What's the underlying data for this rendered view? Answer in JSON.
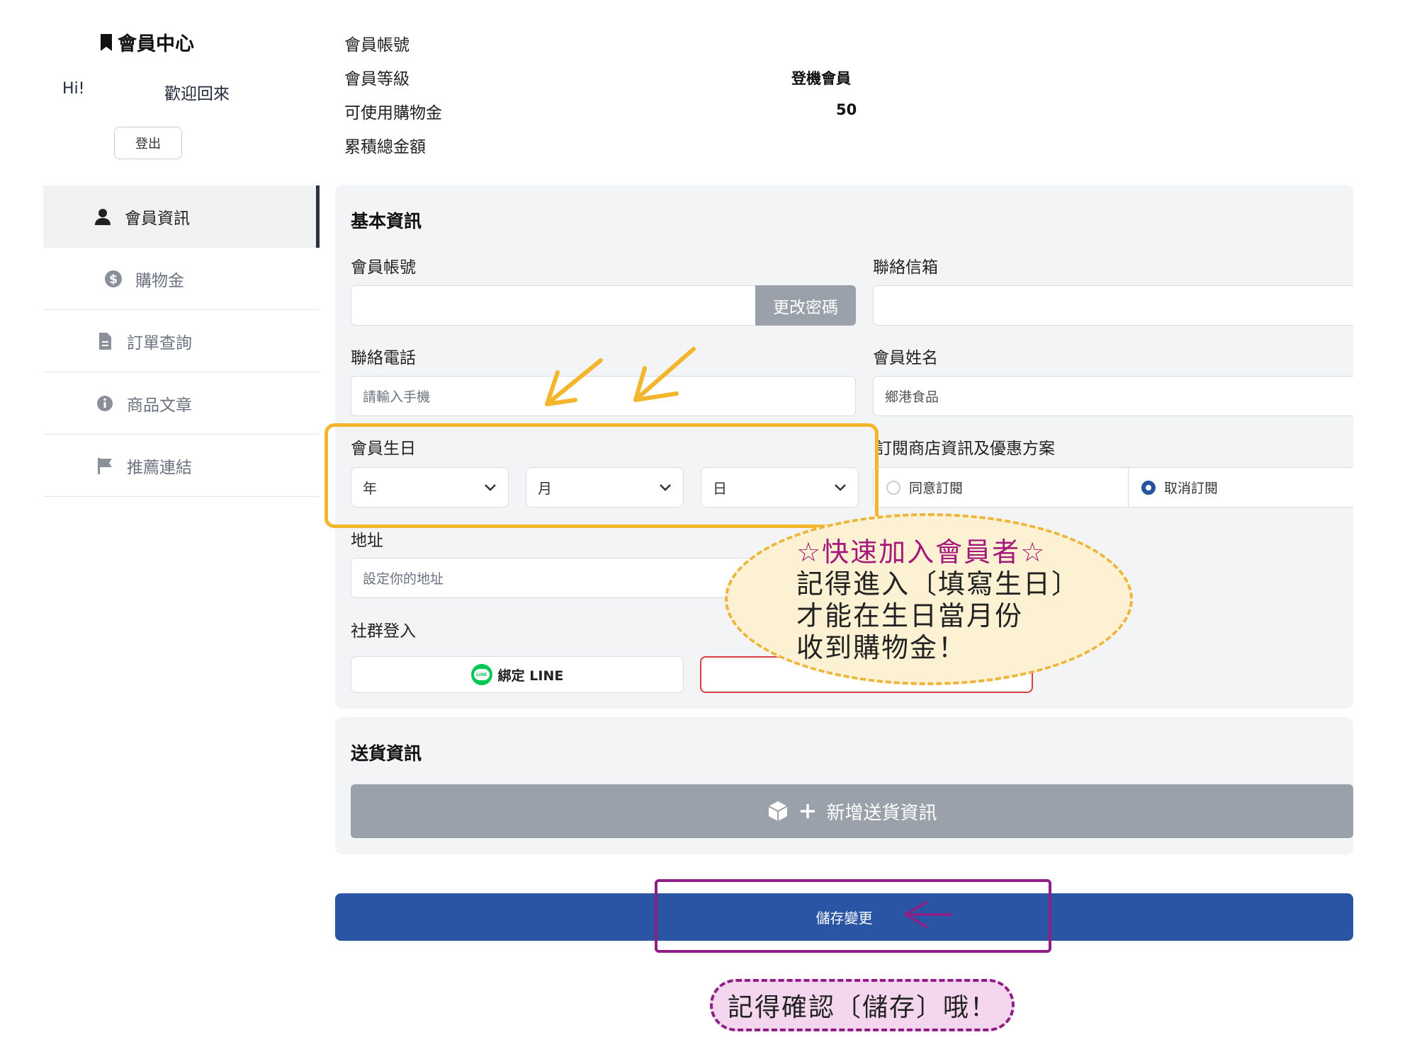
{
  "sidebar": {
    "brand": "會員中心",
    "greeting": "Hi!",
    "welcome": "歡迎回來",
    "logout_label": "登出",
    "items": [
      {
        "label": "會員資訊",
        "icon": "user-icon",
        "active": true
      },
      {
        "label": "購物金",
        "icon": "dollar-icon",
        "active": false
      },
      {
        "label": "訂單查詢",
        "icon": "document-icon",
        "active": false
      },
      {
        "label": "商品文章",
        "icon": "info-icon",
        "active": false
      },
      {
        "label": "推薦連結",
        "icon": "flag-icon",
        "active": false
      }
    ]
  },
  "summary": {
    "account_label": "會員帳號",
    "level_label": "會員等級",
    "level_value": "登機會員",
    "credit_label": "可使用購物金",
    "credit_value": "50",
    "total_label": "累積總金額"
  },
  "basic": {
    "title": "基本資訊",
    "account_label": "會員帳號",
    "change_password": "更改密碼",
    "email_label": "聯絡信箱",
    "phone_label": "聯絡電話",
    "phone_placeholder": "請輸入手機",
    "name_label": "會員姓名",
    "name_value": "鄉港食品",
    "birthday_label": "會員生日",
    "year": "年",
    "month": "月",
    "day": "日",
    "subscribe_label": "訂閱商店資訊及優惠方案",
    "subscribe_agree": "同意訂閱",
    "subscribe_cancel": "取消訂閱",
    "address_label": "地址",
    "address_placeholder": "設定你的地址",
    "social_label": "社群登入",
    "line_bind": "綁定 LINE",
    "line_logo_text": "LINE"
  },
  "shipping": {
    "title": "送貨資訊",
    "add_label": "新增送貨資訊"
  },
  "save_label": "儲存變更",
  "annotations": {
    "bubble_line1": "☆快速加入會員者☆",
    "bubble_line2": "記得進入〔填寫生日〕",
    "bubble_line3": "才能在生日當月份",
    "bubble_line4": "收到購物金！",
    "reminder": "記得確認〔儲存〕哦！"
  },
  "colors": {
    "accent": "#2a55a4",
    "highlight_orange": "#f2b52b",
    "highlight_purple": "#8f1f86",
    "bubble_text": "#a3187a"
  }
}
